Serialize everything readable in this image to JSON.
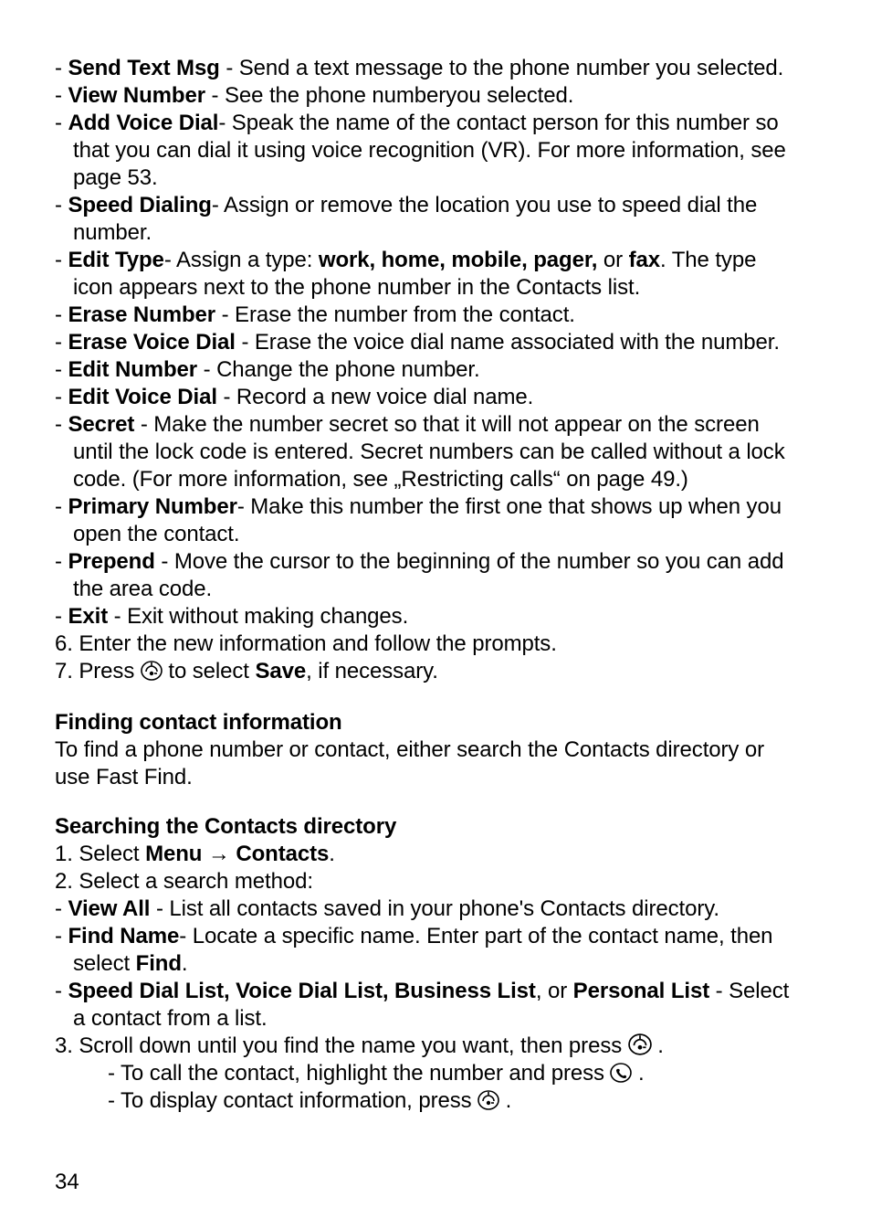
{
  "list1": [
    {
      "term": "Send Text Msg",
      "prefix": "- ",
      "joiner": " - ",
      "desc": "Send a text message to the phone number you selected."
    },
    {
      "term": "View Number",
      "prefix": "- ",
      "joiner": " - ",
      "desc": "See the phone numberyou selected."
    },
    {
      "term": "Add Voice Dial",
      "prefix": "-  ",
      "joiner": "- ",
      "desc": "Speak the name of the contact person for this number so",
      "cont": [
        "that you can dial it using voice recognition (VR). For more information, see",
        "page 53."
      ]
    },
    {
      "term": "Speed Dialing",
      "prefix": "-  ",
      "joiner": "- ",
      "desc": "Assign or remove the location you use to speed dial the",
      "cont": [
        "number."
      ]
    },
    {
      "term": "Edit Type",
      "prefix": "-  ",
      "joiner": "- ",
      "desc_pre": "Assign a type: ",
      "bold2": "work, home, mobile, pager,",
      "desc_mid": " or ",
      "bold3": "fax",
      "desc_post": ". The type",
      "cont": [
        "icon appears next to the phone number in the Contacts list."
      ]
    },
    {
      "term": "Erase Number",
      "prefix": "- ",
      "joiner": " - ",
      "desc": "Erase the number from the contact."
    },
    {
      "term": "Erase Voice Dial",
      "prefix": "- ",
      "joiner": " - ",
      "desc": "Erase the voice dial name associated with the number."
    },
    {
      "term": "Edit Number",
      "prefix": "- ",
      "joiner": " - ",
      "desc": "Change the phone number."
    },
    {
      "term": "Edit Voice Dial",
      "prefix": "- ",
      "joiner": " - ",
      "desc": "Record a new voice dial name."
    },
    {
      "term": "Secret",
      "prefix": "- ",
      "joiner": " - ",
      "desc": "Make the number secret so that it will not appear on the screen",
      "cont": [
        "until the lock code is entered. Secret numbers can be called without a lock",
        "code. (For more information, see „Restricting calls“ on page 49.)"
      ]
    },
    {
      "term": "Primary Number",
      "prefix": "-  ",
      "joiner": "- ",
      "desc": "Make this number the first one that shows up when you",
      "cont": [
        "open the contact."
      ]
    },
    {
      "term": "Prepend",
      "prefix": "- ",
      "joiner": " - ",
      "desc": "Move the cursor to the beginning of the number so you can add",
      "cont": [
        "the area code."
      ]
    },
    {
      "term": "Exit",
      "prefix": "- ",
      "joiner": " - ",
      "desc": "Exit without making changes."
    }
  ],
  "step6": "6. Enter the new information and follow the prompts.",
  "step7_pre": "7. Press ",
  "step7_mid": " to select ",
  "step7_bold": "Save",
  "step7_post": ", if necessary.",
  "h_finding": "Finding contact information",
  "p_finding_l1": "To find a phone number or contact, either search the Contacts directory or",
  "p_finding_l2": "use Fast Find.",
  "h_searching": "Searching the Contacts directory",
  "s1_pre": "1. Select ",
  "s1_b1": "Menu",
  "s1_arrow": " → ",
  "s1_b2": "Contacts",
  "s1_post": ".",
  "s2": "2. Select a search method:",
  "list2": [
    {
      "term": "View All",
      "prefix": "- ",
      "joiner": " - ",
      "desc": "List all contacts saved in your phone's Contacts directory."
    },
    {
      "term": "Find Name",
      "prefix": "-  ",
      "joiner": "- ",
      "desc": "Locate a specific name. Enter part of the contact name, then",
      "cont_pre": "select ",
      "cont_bold": "Find",
      "cont_post": "."
    },
    {
      "term": "Speed Dial List, Voice Dial List, Business List",
      "prefix": "-  ",
      "mid": ", or ",
      "term2": "Personal List",
      "joiner": " - ",
      "desc": "Select",
      "cont": [
        "a contact from a list."
      ]
    }
  ],
  "s3_pre": "3. Scroll down until you find the name you want, then press ",
  "s3_post": " .",
  "s3a_pre": "- To call the contact, highlight the number and press ",
  "s3a_post": " .",
  "s3b_pre": "- To display contact information, press ",
  "s3b_post": " .",
  "page_number": "34"
}
